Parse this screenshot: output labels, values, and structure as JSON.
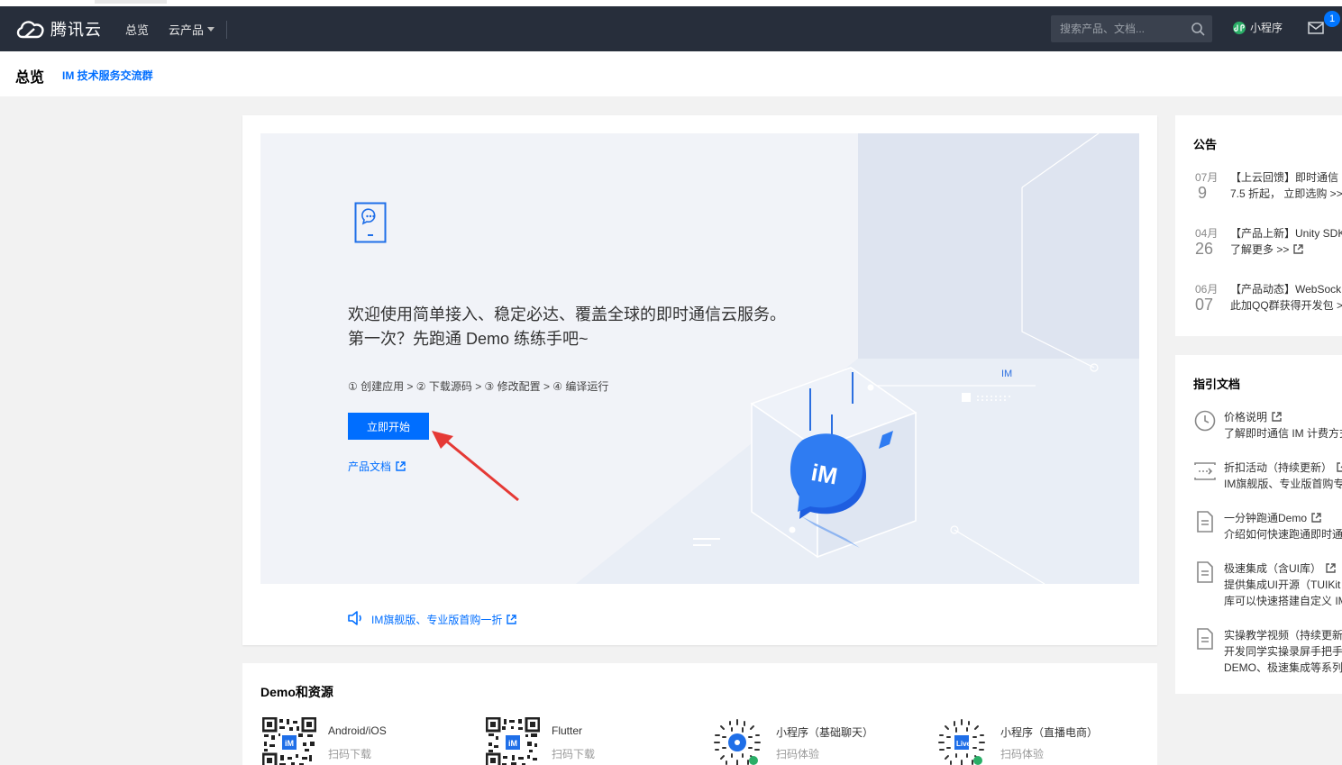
{
  "nav": {
    "brand": "腾讯云",
    "overview": "总览",
    "products": "云产品",
    "search_placeholder": "搜索产品、文档...",
    "mini_program": "小程序",
    "badge_count": "1"
  },
  "subheader": {
    "title": "总览",
    "link": "IM 技术服务交流群"
  },
  "hero": {
    "welcome_line1": "欢迎使用简单接入、稳定必达、覆盖全球的即时通信云服务。",
    "welcome_line2": "第一次？先跑通 Demo 练练手吧~",
    "steps": "① 创建应用 > ② 下载源码 > ③ 修改配置 > ④ 编译运行",
    "start_button": "立即开始",
    "doc_link": "产品文档",
    "art_label": "IM",
    "logo_text": "iM"
  },
  "promo": {
    "text": "IM旗舰版、专业版首购一折"
  },
  "demo": {
    "title": "Demo和资源",
    "items": [
      {
        "name": "Android/iOS",
        "sub": "扫码下载"
      },
      {
        "name": "Flutter",
        "sub": "扫码下载"
      },
      {
        "name": "小程序（基础聊天）",
        "sub": "扫码体验"
      },
      {
        "name": "小程序（直播电商）",
        "sub": "扫码体验"
      }
    ]
  },
  "notice": {
    "title": "公告",
    "items": [
      {
        "month": "07月",
        "day": "9",
        "line1": "【上云回馈】即时通信",
        "line2": "7.5 折起， 立即选购 >>"
      },
      {
        "month": "04月",
        "day": "26",
        "line1": "【产品上新】Unity SDK",
        "line2": "了解更多 >>"
      },
      {
        "month": "06月",
        "day": "07",
        "line1": "【产品动态】WebSock",
        "line2": "此加QQ群获得开发包 >"
      }
    ]
  },
  "guide": {
    "title": "指引文档",
    "items": [
      {
        "title": "价格说明",
        "desc1": "了解即时通信 IM 计费方式",
        "desc2": ""
      },
      {
        "title": "折扣活动（持续更新）",
        "desc1": "IM旗舰版、专业版首购专",
        "desc2": ""
      },
      {
        "title": "一分钟跑通Demo",
        "desc1": "介绍如何快速跑通即时通",
        "desc2": ""
      },
      {
        "title": "极速集成（含UI库）",
        "desc1": "提供集成UI开源（TUIKit",
        "desc2": "库可以快速搭建自定义 IM"
      },
      {
        "title": "实操教学视频（持续更新",
        "desc1": "开发同学实操录屏手把手",
        "desc2": "DEMO、极速集成等系列"
      }
    ]
  }
}
